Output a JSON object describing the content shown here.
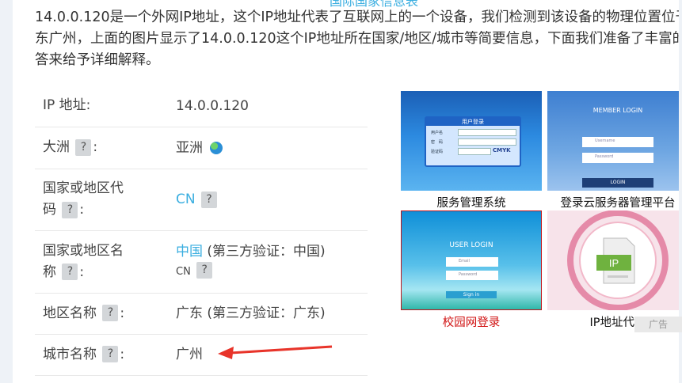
{
  "header_partial": "国际国家信息表",
  "intro": {
    "line1": "14.0.0.120是一个外网IP地址，这个IP地址代表了互联网上的一个设备，我们检测到该设备的物理位置位于",
    "line2": "东广州，上面的图片显示了14.0.0.120这个IP地址所在国家/地区/城市等简要信息，下面我们准备了丰富的",
    "line3": "答来给予详细解释。"
  },
  "info": {
    "ip_label": "IP 地址:",
    "ip_value": "14.0.0.120",
    "continent_label": "大洲",
    "continent_value": "亚洲",
    "country_code_label_1": "国家或地区代",
    "country_code_label_2": "码",
    "country_code_value": "CN",
    "country_name_label_1": "国家或地区名",
    "country_name_label_2": "称",
    "country_name_value": "中国",
    "country_name_verify": "(第三方验证：中国)",
    "country_name_code": "CN",
    "region_label": "地区名称",
    "region_value": "广东 (第三方验证：广东)",
    "city_label": "城市名称",
    "city_value": "广州",
    "help_mark": "?",
    "colon": ":"
  },
  "ads": [
    {
      "caption": "服务管理系统",
      "title_text": "用户登录",
      "field1": "用户名",
      "field2": "密　码",
      "field3": "验证码",
      "tag": "CMYK"
    },
    {
      "caption": "登录云服务器管理平台",
      "title_text": "MEMBER LOGIN",
      "field1": "Username",
      "field2": "Password",
      "button": "LOGIN"
    },
    {
      "caption": "校园网登录",
      "title_text": "USER LOGIN",
      "field1": "Email",
      "field2": "Password",
      "button": "Sign in"
    },
    {
      "caption": "IP地址代理",
      "badge_text": "IP"
    }
  ],
  "ad_badge": "广告",
  "colors": {
    "link": "#3aaee0",
    "arrow": "#e8342a",
    "ad_highlight": "#d01010"
  }
}
